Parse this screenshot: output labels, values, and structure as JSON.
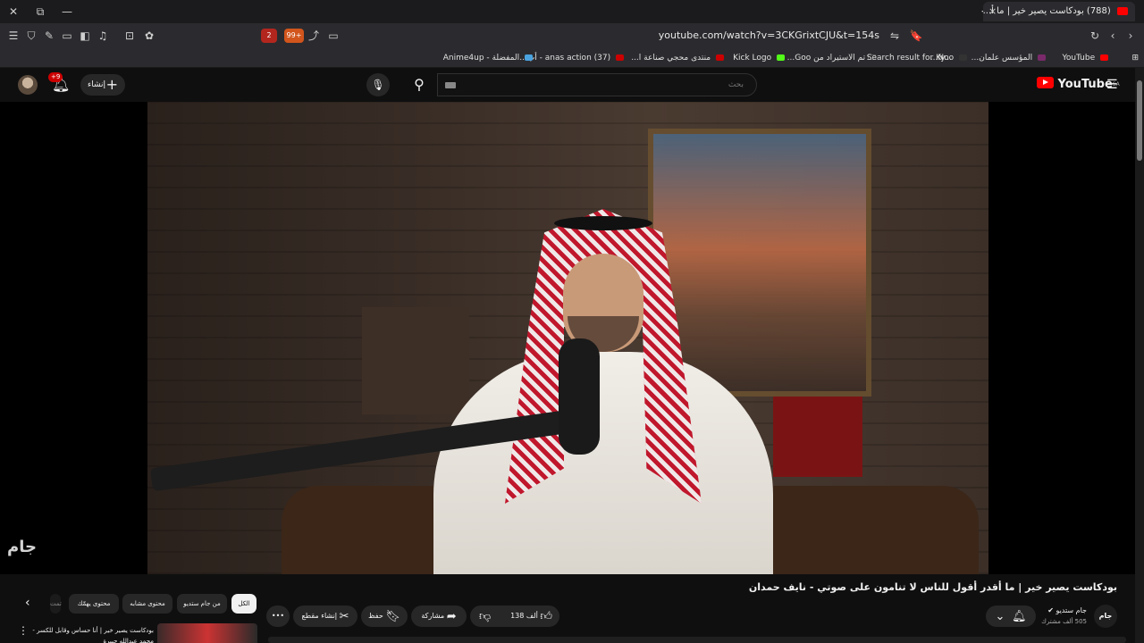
{
  "browser": {
    "tab_title": "(788) بودكاست يصير خير | ما أ...",
    "tab_close": "×",
    "new_tab": "+",
    "window_close": "✕",
    "window_restore": "⧉",
    "window_minimize": "—",
    "url": "youtube.com/watch?v=3CKGrixtCJU&t=154s",
    "ext_badge_1": "2",
    "ext_badge_2": "99+"
  },
  "bookmarks": [
    {
      "label": "YouTube",
      "color": "#ff0000"
    },
    {
      "label": "المؤسس علمان...",
      "color": "#7a2a6a"
    },
    {
      "label": "Noo...",
      "color": "#333333"
    },
    {
      "label": "Search result for Ky...",
      "color": "#2b2b2f"
    },
    {
      "label": "تم الاستيراد من Goo...",
      "color": "#2b2b2f"
    },
    {
      "label": "Kick Logo",
      "color": "#53fc18"
    },
    {
      "label": "منتدى محجي صناعة ا...",
      "color": "#cc0000"
    },
    {
      "label": "(37) anas action - أب...",
      "color": "#cc0000"
    },
    {
      "label": "المفضلة - Anime4up",
      "color": "#4aa3df"
    }
  ],
  "masthead": {
    "search_placeholder": "بحث",
    "create_label": "إنشاء",
    "notif_count": "+9",
    "logo_text": "YouTube",
    "logo_region": "SA"
  },
  "video": {
    "title": "بودكاست يصير خير | ما أقدر أقول للناس لا تنامون على صوتي - نايف حمدان",
    "watermark": "جام",
    "channel_name": "جام ستديو",
    "channel_avatar": "جام",
    "subscribers": "505 ألف مشترك",
    "likes": "138 ألف",
    "share_label": "مشاركة",
    "save_label": "حفظ",
    "clip_label": "إنشاء مقطع",
    "more_label": "•••"
  },
  "chips": [
    {
      "label": "الكل",
      "active": true
    },
    {
      "label": "من جام ستديو",
      "active": false
    },
    {
      "label": "محتوى مشابه",
      "active": false
    },
    {
      "label": "محتوى يهمّك",
      "active": false
    },
    {
      "label": "تمت",
      "active": false
    }
  ],
  "related": {
    "title": "بودكاست يصير خير | أنا حساس وقابل للكسر - محمد عبدالله جبيرة"
  },
  "icons": [
    "close-icon",
    "restore-icon",
    "minimize-icon",
    "menu-icon",
    "shield-icon",
    "bell-icon",
    "search-icon",
    "mic-icon",
    "thumbs-up-icon",
    "thumbs-down-icon",
    "share-icon",
    "save-icon",
    "scissors-icon",
    "chevron-down-icon",
    "chevron-left-icon",
    "reload-icon",
    "bookmark-icon"
  ],
  "colors": {
    "accent": "#ff0000",
    "background": "#0f0f0f",
    "chip_active": "#f1f1f1"
  }
}
